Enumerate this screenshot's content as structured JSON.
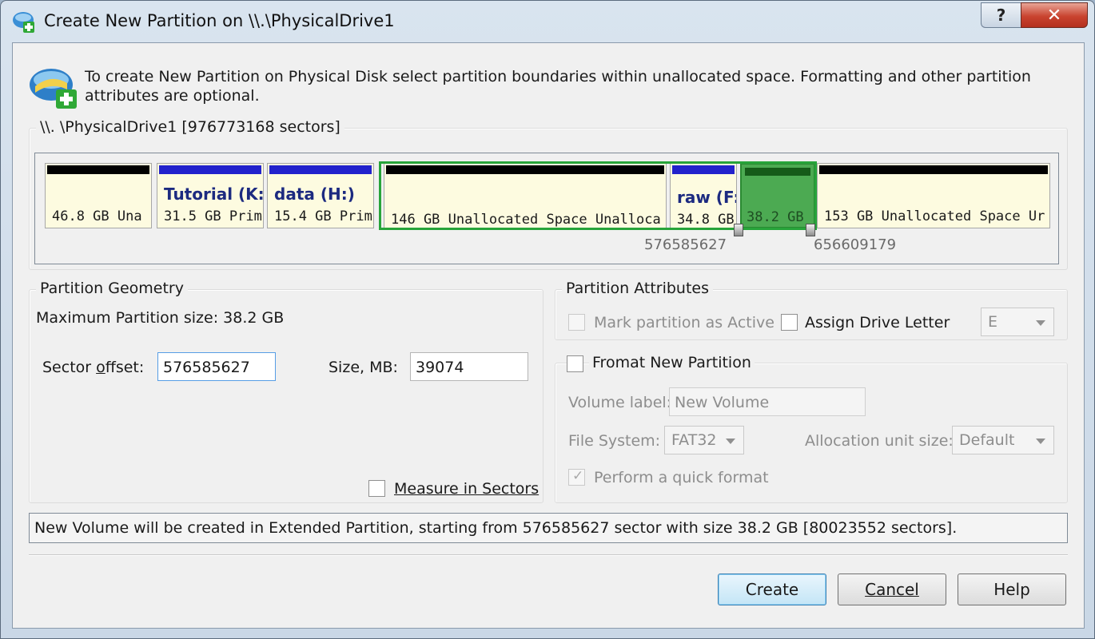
{
  "window": {
    "title": "Create New Partition on \\\\.\\PhysicalDrive1",
    "help_button": "?",
    "close_button": "✕"
  },
  "header": {
    "text": "To create New Partition on Physical Disk select partition boundaries within unallocated space. Formatting and other partition attributes are optional."
  },
  "disk": {
    "group_label": "\\\\. \\PhysicalDrive1 [976773168 sectors]",
    "partitions": [
      {
        "name": "",
        "size": "46.8 GB Una"
      },
      {
        "name": "Tutorial (K:)",
        "size": "31.5 GB Prim"
      },
      {
        "name": "data (H:)",
        "size": "15.4 GB Prim"
      },
      {
        "name": "",
        "size": "146 GB Unallocated Space Unalloca"
      },
      {
        "name": "raw (F:",
        "size": "34.8 GB"
      },
      {
        "name": "",
        "size": "153 GB Unallocated Space Ur"
      }
    ],
    "new_partition_size": "38.2 GB",
    "marker_start": "576585627",
    "marker_end": "656609179",
    "colors": {
      "unallocated_bar": "#000000",
      "primary_bar": "#2222cc",
      "new_partition": "#4caa52",
      "selection": "#27a43a"
    }
  },
  "geometry": {
    "group_label": "Partition Geometry",
    "max_size": "Maximum Partition size: 38.2 GB",
    "sector_offset_label": "Sector offset:",
    "sector_offset_value": "576585627",
    "size_label": "Size, MB:",
    "size_value": "39074",
    "measure_label": "Measure in Sectors"
  },
  "attributes": {
    "group_label": "Partition Attributes",
    "mark_active": "Mark partition as Active",
    "assign_letter": "Assign Drive Letter",
    "drive_letter": "E"
  },
  "format": {
    "group_label": "Fromat New Partition",
    "volume_label_label": "Volume label:",
    "volume_label_value": "New Volume",
    "fs_label": "File System:",
    "fs_value": "FAT32",
    "alloc_label": "Allocation unit size:",
    "alloc_value": "Default",
    "quick_format": "Perform a quick format"
  },
  "status": {
    "text": "New Volume will be created in Extended Partition, starting from 576585627 sector with size 38.2 GB [80023552 sectors]."
  },
  "buttons": {
    "create": "Create",
    "cancel": "Cancel",
    "help": "Help"
  }
}
